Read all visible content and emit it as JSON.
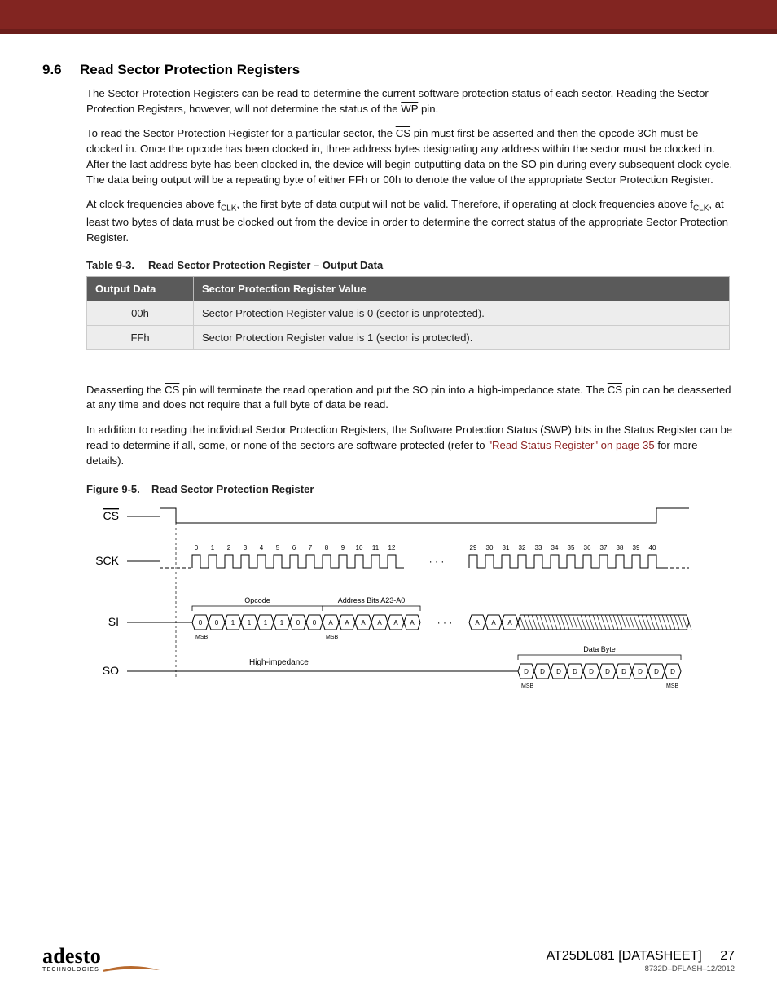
{
  "section": {
    "number": "9.6",
    "title": "Read Sector Protection Registers"
  },
  "paragraphs": {
    "p1_a": "The Sector Protection Registers can be read to determine the current software protection status of each sector. Reading the Sector Protection Registers, however, will not determine the status of the ",
    "p1_wp": "WP",
    "p1_b": " pin.",
    "p2_a": "To read the Sector Protection Register for a particular sector, the ",
    "p2_cs": "CS",
    "p2_b": " pin must first be asserted and then the opcode 3Ch must be clocked in. Once the opcode has been clocked in, three address bytes designating any address within the sector must be clocked in. After the last address byte has been clocked in, the device will begin outputting data on the SO pin during every subsequent clock cycle. The data being output will be a repeating byte of either FFh or 00h to denote the value of the appropriate Sector Protection Register.",
    "p3_a": "At clock frequencies above f",
    "p3_sub1": "CLK",
    "p3_b": ", the first byte of data output will not be valid. Therefore, if operating at clock frequencies above f",
    "p3_sub2": "CLK",
    "p3_c": ", at least two bytes of data must be clocked out from the device in order to determine the correct status of the appropriate Sector Protection Register.",
    "p4_a": "Deasserting the ",
    "p4_cs1": "CS",
    "p4_b": " pin will terminate the read operation and put the SO pin into a high-impedance state. The ",
    "p4_cs2": "CS",
    "p4_c": " pin can be deasserted at any time and does not require that a full byte of data be read.",
    "p5_a": "In addition to reading the individual Sector Protection Registers, the Software Protection Status (SWP) bits in the Status Register can be read to determine if all, some, or none of the sectors are software protected (refer to ",
    "p5_link": "\"Read Status Register\" on page 35",
    "p5_b": " for more details)."
  },
  "table": {
    "caption_num": "Table 9-3.",
    "caption_text": "Read Sector Protection Register – Output Data",
    "headers": [
      "Output Data",
      "Sector Protection Register Value"
    ],
    "rows": [
      [
        "00h",
        "Sector Protection Register value is 0 (sector is unprotected)."
      ],
      [
        "FFh",
        "Sector Protection Register value is 1 (sector is protected)."
      ]
    ]
  },
  "figure": {
    "caption_num": "Figure 9-5.",
    "caption_text": "Read Sector Protection Register",
    "signals": {
      "cs": "CS",
      "sck": "SCK",
      "si": "SI",
      "so": "SO"
    },
    "clock_ticks_left": [
      "0",
      "1",
      "2",
      "3",
      "4",
      "5",
      "6",
      "7",
      "8",
      "9",
      "10",
      "11",
      "12"
    ],
    "clock_ticks_right": [
      "29",
      "30",
      "31",
      "32",
      "33",
      "34",
      "35",
      "36",
      "37",
      "38",
      "39",
      "40"
    ],
    "labels": {
      "opcode": "Opcode",
      "addr": "Address Bits A23-A0",
      "hiz": "High-impedance",
      "databyte": "Data Byte",
      "msb": "MSB"
    },
    "si_opcode_bits": [
      "0",
      "0",
      "1",
      "1",
      "1",
      "1",
      "0",
      "0"
    ],
    "si_addr_left": [
      "A",
      "A",
      "A",
      "A",
      "A",
      "A"
    ],
    "si_addr_right": [
      "A",
      "A",
      "A"
    ],
    "so_bits": [
      "D",
      "D",
      "D",
      "D",
      "D",
      "D",
      "D",
      "D",
      "D",
      "D"
    ]
  },
  "footer": {
    "logo_main": "adesto",
    "logo_sub": "TECHNOLOGIES",
    "doc_title": "AT25DL081 [DATASHEET]",
    "page_num": "27",
    "doc_code": "8732D–DFLASH–12/2012"
  }
}
